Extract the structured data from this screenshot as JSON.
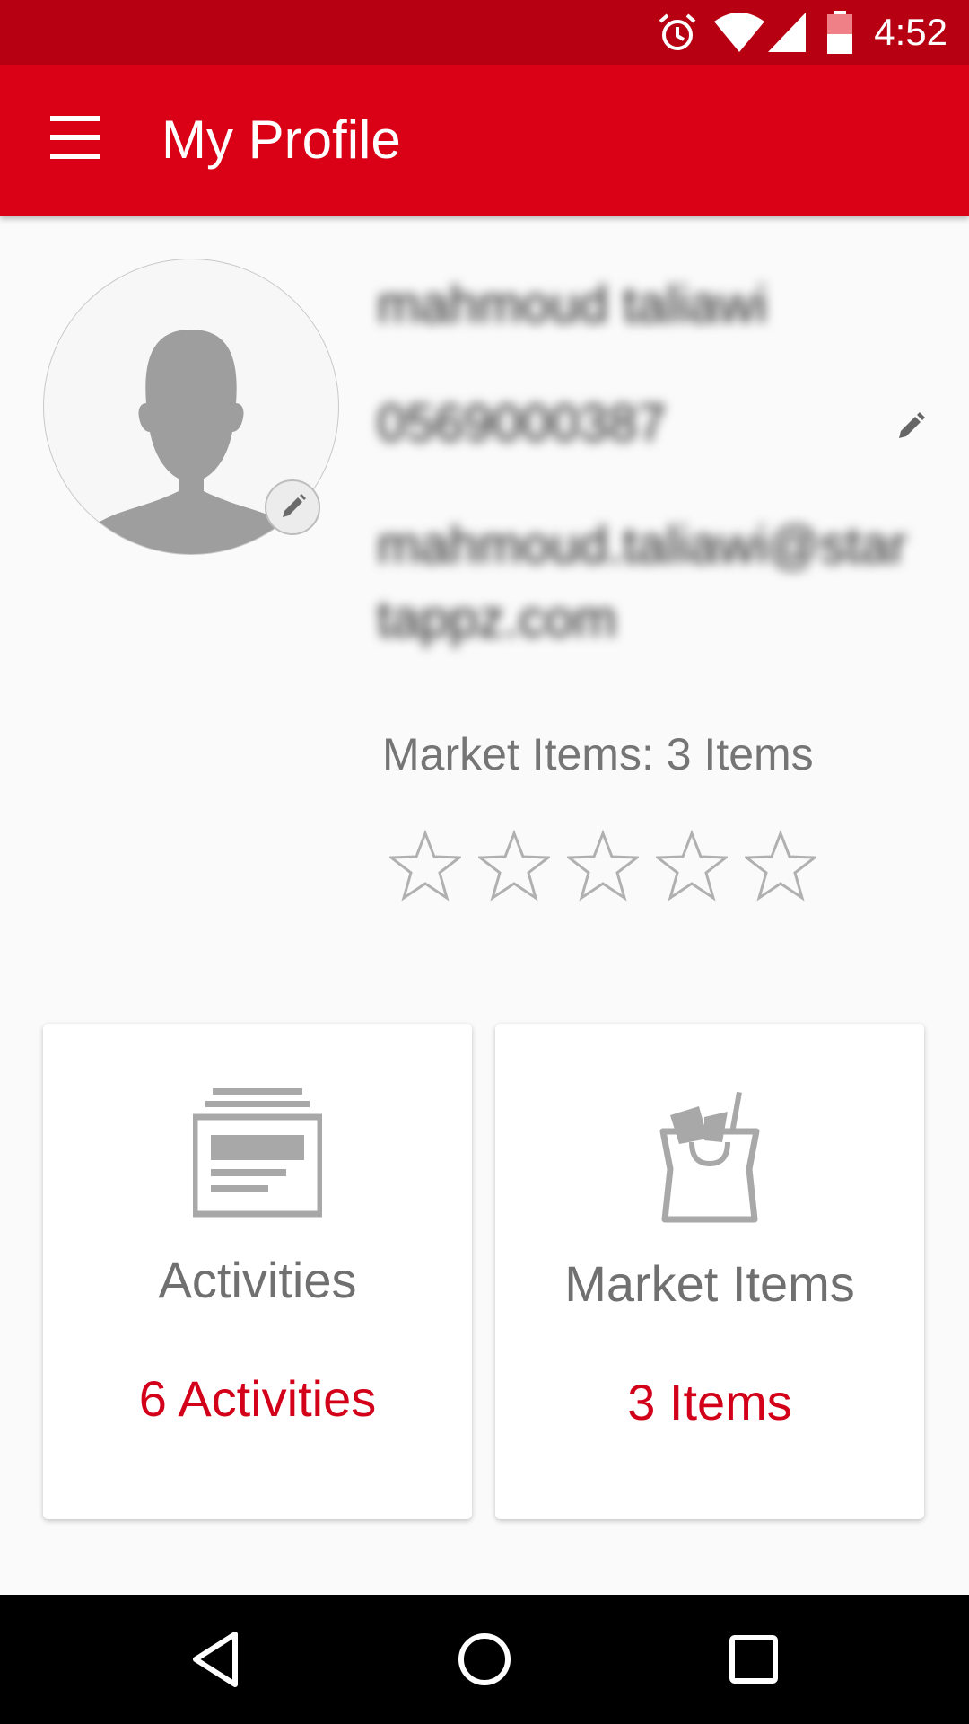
{
  "status_bar": {
    "time": "4:52",
    "icons": [
      "alarm-icon",
      "wifi-icon",
      "signal-icon",
      "battery-icon"
    ]
  },
  "app_bar": {
    "title": "My Profile",
    "menu_icon": "hamburger-icon"
  },
  "profile": {
    "name": "mahmoud taliawi",
    "phone": "0569000387",
    "email_line1": "mahmoud.taliawi@star",
    "email_line2": "tappz.com",
    "market_items_text": "Market Items: 3 Items",
    "rating": 0,
    "rating_max": 5
  },
  "cards": [
    {
      "label": "Activities",
      "count": "6 Activities",
      "icon": "activities-icon"
    },
    {
      "label": "Market Items",
      "count": "3 Items",
      "icon": "shopping-bag-icon"
    }
  ],
  "colors": {
    "status_bar": "#b70012",
    "app_bar": "#da0016",
    "accent_text": "#d3001a",
    "secondary_text": "#757575"
  },
  "nav_bar": {
    "buttons": [
      "back-icon",
      "home-icon",
      "recents-icon"
    ]
  }
}
